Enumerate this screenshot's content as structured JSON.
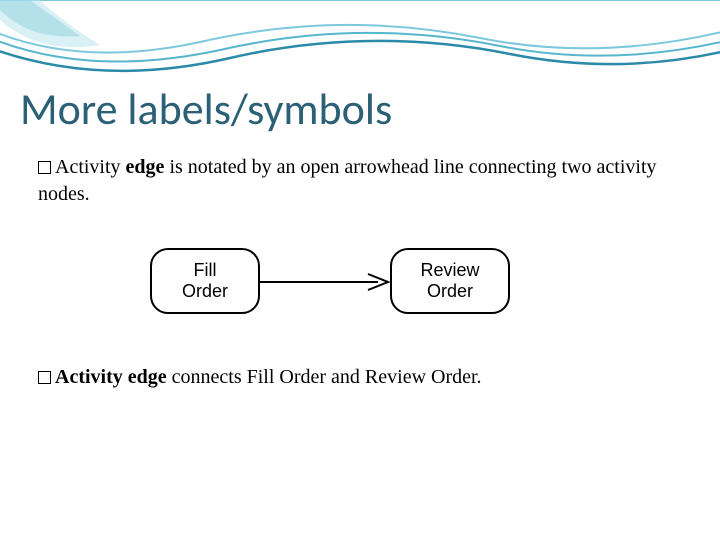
{
  "title": "More labels/symbols",
  "bullets": {
    "b1_prefix": "Activity ",
    "b1_bold": "edge",
    "b1_rest": " is notated by an open arrowhead line connecting two activity nodes.",
    "b2_bold": "Activity edge",
    "b2_rest": " connects Fill Order and Review Order."
  },
  "diagram": {
    "node_left": "Fill\nOrder",
    "node_right": "Review\nOrder"
  }
}
